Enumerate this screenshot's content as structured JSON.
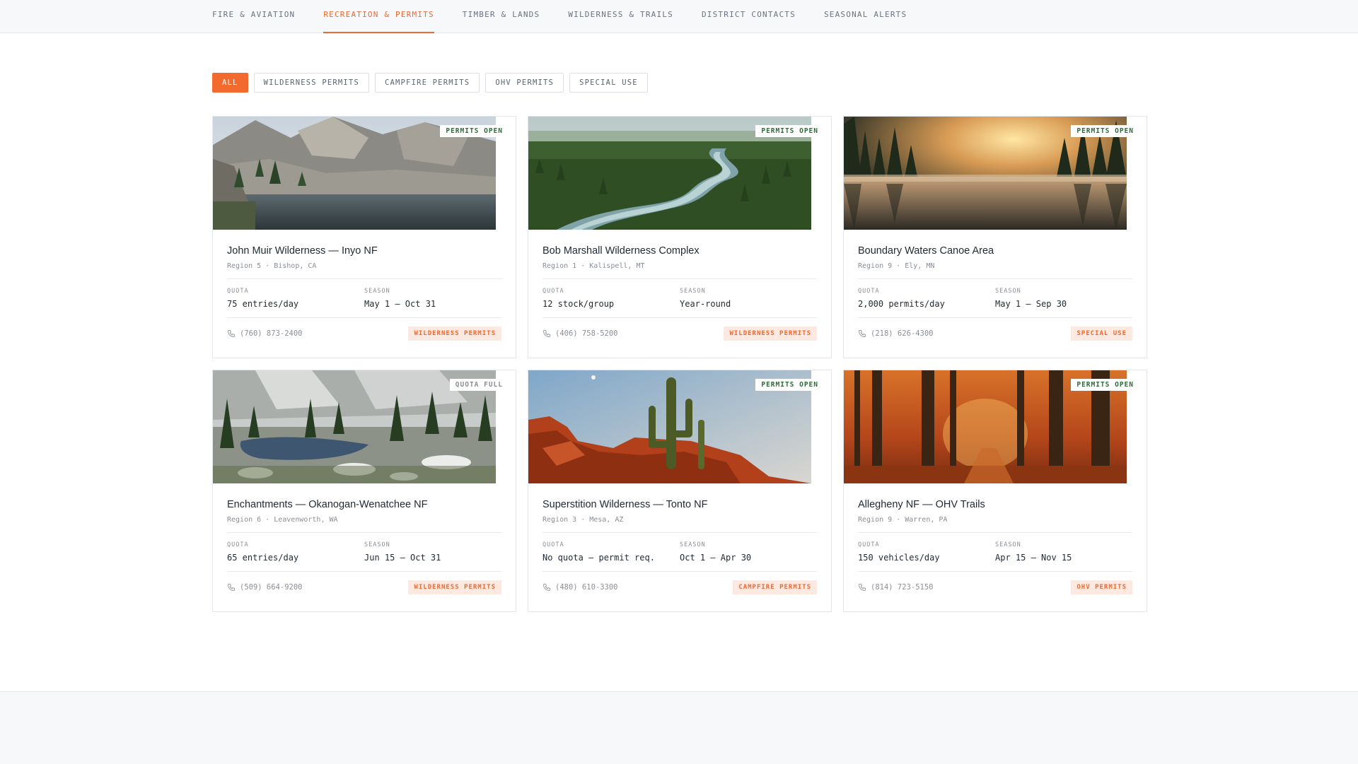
{
  "nav": {
    "items": [
      {
        "label": "FIRE & AVIATION",
        "active": false
      },
      {
        "label": "RECREATION & PERMITS",
        "active": true
      },
      {
        "label": "TIMBER & LANDS",
        "active": false
      },
      {
        "label": "WILDERNESS & TRAILS",
        "active": false
      },
      {
        "label": "DISTRICT CONTACTS",
        "active": false
      },
      {
        "label": "SEASONAL ALERTS",
        "active": false
      }
    ]
  },
  "filters": {
    "chips": [
      {
        "label": "ALL",
        "active": true
      },
      {
        "label": "WILDERNESS PERMITS",
        "active": false
      },
      {
        "label": "CAMPFIRE PERMITS",
        "active": false
      },
      {
        "label": "OHV PERMITS",
        "active": false
      },
      {
        "label": "SPECIAL USE",
        "active": false
      }
    ]
  },
  "colors": {
    "accent": "#f26a2e",
    "open_status": "#2f6b3a",
    "full_status": "#8a8f96",
    "badge_bg": "#fde9df"
  },
  "cards": [
    {
      "title": "John Muir Wilderness — Inyo NF",
      "subtitle": "Region 5 · Bishop, CA",
      "status": "PERMITS OPEN",
      "quota_label": "QUOTA",
      "quota": "75 entries/day",
      "season_label": "SEASON",
      "season": "May 1 – Oct 31",
      "phone": "(760) 873-2400",
      "type": "WILDERNESS PERMITS",
      "image": "alpine-lake-mountains"
    },
    {
      "title": "Bob Marshall Wilderness Complex",
      "subtitle": "Region 1 · Kalispell, MT",
      "status": "PERMITS OPEN",
      "quota_label": "QUOTA",
      "quota": "12 stock/group",
      "season_label": "SEASON",
      "season": "Year-round",
      "phone": "(406) 758-5200",
      "type": "WILDERNESS PERMITS",
      "image": "forest-river-valley"
    },
    {
      "title": "Boundary Waters Canoe Area",
      "subtitle": "Region 9 · Ely, MN",
      "status": "PERMITS OPEN",
      "quota_label": "QUOTA",
      "quota": "2,000 permits/day",
      "season_label": "SEASON",
      "season": "May 1 – Sep 30",
      "phone": "(218) 626-4300",
      "type": "SPECIAL USE",
      "image": "misty-lake-sunrise"
    },
    {
      "title": "Enchantments — Okanogan-Wenatchee NF",
      "subtitle": "Region 6 · Leavenworth, WA",
      "status": "QUOTA FULL",
      "quota_label": "QUOTA",
      "quota": "65 entries/day",
      "season_label": "SEASON",
      "season": "Jun 15 – Oct 31",
      "phone": "(509) 664-9200",
      "type": "WILDERNESS PERMITS",
      "image": "granite-alpine-lake"
    },
    {
      "title": "Superstition Wilderness — Tonto NF",
      "subtitle": "Region 3 · Mesa, AZ",
      "status": "PERMITS OPEN",
      "quota_label": "QUOTA",
      "quota": "No quota — permit req.",
      "season_label": "SEASON",
      "season": "Oct 1 – Apr 30",
      "phone": "(480) 610-3300",
      "type": "CAMPFIRE PERMITS",
      "image": "desert-saguaro"
    },
    {
      "title": "Allegheny NF — OHV Trails",
      "subtitle": "Region 9 · Warren, PA",
      "status": "PERMITS OPEN",
      "quota_label": "QUOTA",
      "quota": "150 vehicles/day",
      "season_label": "SEASON",
      "season": "Apr 15 – Nov 15",
      "phone": "(814) 723-5150",
      "type": "OHV PERMITS",
      "image": "autumn-forest"
    }
  ]
}
